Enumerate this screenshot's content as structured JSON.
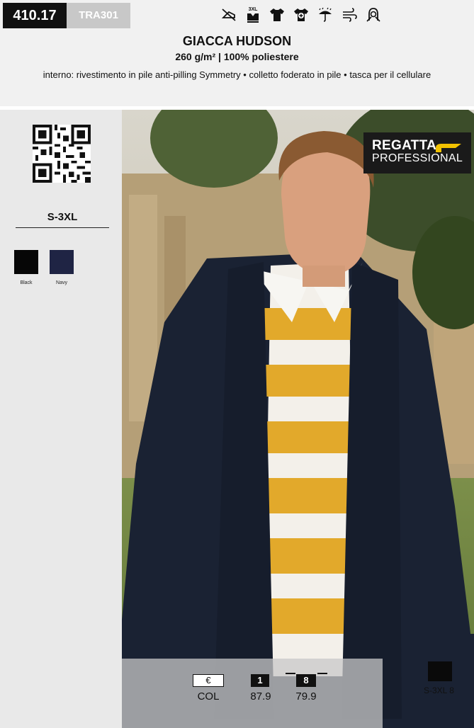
{
  "header": {
    "code": "410.17",
    "sku": "TRA301",
    "care_icons": [
      "no-iron-icon",
      "size-3xl-plus-icon",
      "tshirt-icon",
      "tshirt-plus-icon",
      "rain-protection-icon",
      "windproof-icon",
      "hood-icon"
    ],
    "care_icon_texts": {
      "size": "3XL"
    }
  },
  "product": {
    "title": "GIACCA HUDSON",
    "subtitle": "260 g/m² | 100% poliestere",
    "features": "interno: rivestimento in pile anti-pilling Symmetry  • colletto foderato in pile • tasca per il cellulare"
  },
  "sidebar": {
    "sizes": "S-3XL",
    "colors": [
      {
        "name": "Black",
        "hex": "#060606"
      },
      {
        "name": "Navy",
        "hex": "#1f2444"
      }
    ]
  },
  "brand": {
    "line1": "REGATTA",
    "line2": "PROFESSIONAL",
    "mark_color": "#f2c200"
  },
  "pricing": {
    "currency": "€",
    "col_label": "COL",
    "tiers": [
      {
        "qty": "1",
        "price": "87.9"
      },
      {
        "qty": "8",
        "price": "79.9"
      }
    ],
    "size_range": "S-3XL",
    "size_price": "8"
  }
}
